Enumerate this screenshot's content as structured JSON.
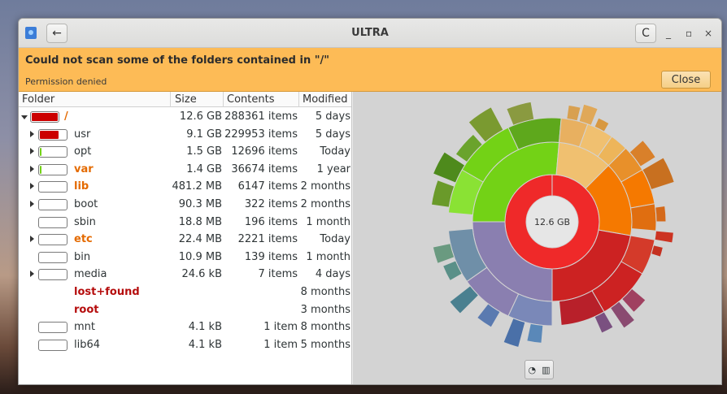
{
  "window": {
    "title": "ULTRA",
    "back_icon": "←",
    "refresh_icon": "C",
    "minimize_icon": "_",
    "maximize_icon": "▫",
    "close_icon": "×"
  },
  "infobar": {
    "title": "Could not scan some of the folders contained in \"/\"",
    "subtitle": "Permission denied",
    "close_label": "Close"
  },
  "tree": {
    "columns": [
      "Folder",
      "Size",
      "Contents",
      "Modified"
    ],
    "rows": [
      {
        "name": "/",
        "size": "12.6 GB",
        "contents": "288361 items",
        "modified": "5 days",
        "style": "warn",
        "expander": "open",
        "fill": 1.0,
        "fill_color": "#cc0000"
      },
      {
        "name": "usr",
        "size": "9.1 GB",
        "contents": "229953 items",
        "modified": "5 days",
        "style": "normal",
        "expander": "closed",
        "fill": 0.72,
        "fill_color": "#cc0000"
      },
      {
        "name": "opt",
        "size": "1.5 GB",
        "contents": "12696 items",
        "modified": "Today",
        "style": "normal",
        "expander": "closed",
        "fill": 0.06,
        "fill_color": "#73d216"
      },
      {
        "name": "var",
        "size": "1.4 GB",
        "contents": "36674 items",
        "modified": "1 year",
        "style": "warn",
        "expander": "closed",
        "fill": 0.06,
        "fill_color": "#73d216"
      },
      {
        "name": "lib",
        "size": "481.2 MB",
        "contents": "6147 items",
        "modified": "2 months",
        "style": "warn",
        "expander": "closed",
        "fill": 0,
        "fill_color": "#73d216"
      },
      {
        "name": "boot",
        "size": "90.3 MB",
        "contents": "322 items",
        "modified": "2 months",
        "style": "normal",
        "expander": "closed",
        "fill": 0,
        "fill_color": "#73d216"
      },
      {
        "name": "sbin",
        "size": "18.8 MB",
        "contents": "196 items",
        "modified": "1 month",
        "style": "normal",
        "expander": "none",
        "fill": 0,
        "fill_color": "#73d216"
      },
      {
        "name": "etc",
        "size": "22.4 MB",
        "contents": "2221 items",
        "modified": "Today",
        "style": "warn",
        "expander": "closed",
        "fill": 0,
        "fill_color": "#73d216"
      },
      {
        "name": "bin",
        "size": "10.9 MB",
        "contents": "139 items",
        "modified": "1 month",
        "style": "normal",
        "expander": "none",
        "fill": 0,
        "fill_color": "#73d216"
      },
      {
        "name": "media",
        "size": "24.6 kB",
        "contents": "7 items",
        "modified": "4 days",
        "style": "normal",
        "expander": "closed",
        "fill": 0,
        "fill_color": "#73d216"
      },
      {
        "name": "lost+found",
        "size": "",
        "contents": "",
        "modified": "8 months",
        "style": "error",
        "expander": "none",
        "fill": null,
        "fill_color": ""
      },
      {
        "name": "root",
        "size": "",
        "contents": "",
        "modified": "3 months",
        "style": "error",
        "expander": "none",
        "fill": null,
        "fill_color": ""
      },
      {
        "name": "mnt",
        "size": "4.1 kB",
        "contents": "1 item",
        "modified": "8 months",
        "style": "normal",
        "expander": "none",
        "fill": 0,
        "fill_color": "#73d216"
      },
      {
        "name": "lib64",
        "size": "4.1 kB",
        "contents": "1 item",
        "modified": "5 months",
        "style": "normal",
        "expander": "none",
        "fill": 0,
        "fill_color": "#73d216"
      }
    ]
  },
  "chart": {
    "center_label": "12.6 GB",
    "view_icons": [
      "rings-chart-icon",
      "treemap-chart-icon"
    ]
  }
}
